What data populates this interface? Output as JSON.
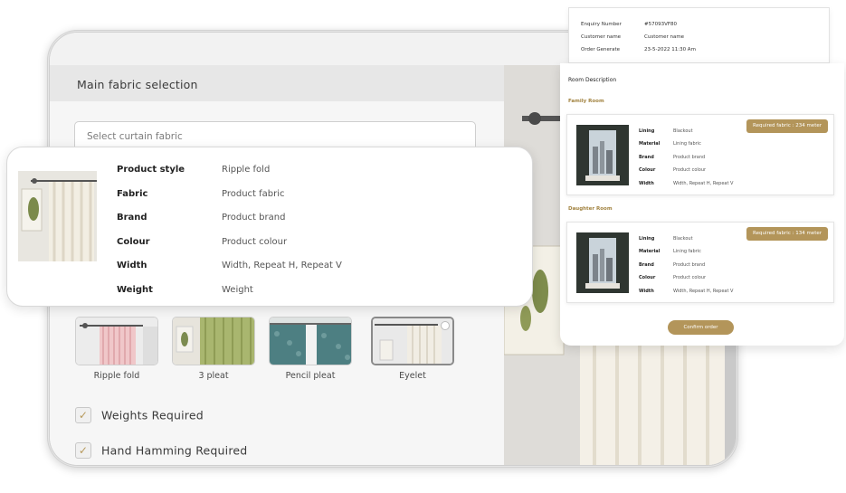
{
  "main": {
    "header_title": "Main fabric selection",
    "search_placeholder": "Select curtain fabric",
    "pleats": [
      {
        "label": "Ripple fold"
      },
      {
        "label": "3 pleat"
      },
      {
        "label": "Pencil pleat"
      },
      {
        "label": "Eyelet",
        "selected": true
      }
    ],
    "checks": [
      {
        "label": "Weights Required",
        "checked": true
      },
      {
        "label": "Hand Hamming Required",
        "checked": true
      }
    ]
  },
  "product": {
    "specs": [
      {
        "key": "Product style",
        "value": "Ripple fold"
      },
      {
        "key": "Fabric",
        "value": "Product fabric"
      },
      {
        "key": "Brand",
        "value": "Product brand"
      },
      {
        "key": "Colour",
        "value": "Product colour"
      },
      {
        "key": "Width",
        "value": "Width, Repeat H, Repeat V"
      },
      {
        "key": "Weight",
        "value": "Weight"
      }
    ]
  },
  "order": {
    "meta": [
      {
        "key": "Enquiry Number",
        "value": "#57093VF80"
      },
      {
        "key": "Customer name",
        "value": "Customer name"
      },
      {
        "key": "Order Generate",
        "value": "23-5-2022 11:30 Am"
      }
    ],
    "room_description_title": "Room Description",
    "rooms": [
      {
        "name": "Family Room",
        "badge": "Required fabric : 234 meter",
        "specs": [
          {
            "key": "Lining",
            "value": "Blackout"
          },
          {
            "key": "Material",
            "value": "Lining fabric"
          },
          {
            "key": "Brand",
            "value": "Product brand"
          },
          {
            "key": "Colour",
            "value": "Product colour"
          },
          {
            "key": "Width",
            "value": "Width, Repeat H, Repeat V"
          }
        ]
      },
      {
        "name": "Daughter Room",
        "badge": "Required fabric : 134 meter",
        "specs": [
          {
            "key": "Lining",
            "value": "Blackout"
          },
          {
            "key": "Material",
            "value": "Lining fabric"
          },
          {
            "key": "Brand",
            "value": "Product brand"
          },
          {
            "key": "Colour",
            "value": "Product colour"
          },
          {
            "key": "Width",
            "value": "Width, Repeat H, Repeat V"
          }
        ]
      }
    ],
    "confirm_label": "Confirm order"
  },
  "colors": {
    "accent": "#b3955a",
    "accent_text": "#a1823f",
    "panel_header": "#e7e7e7"
  },
  "icons": [
    "check-icon",
    "curtain-rod-icon"
  ]
}
